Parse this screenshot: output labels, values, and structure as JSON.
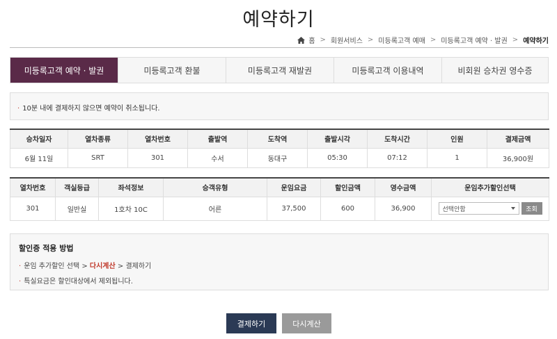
{
  "page": {
    "title": "예약하기"
  },
  "breadcrumb": {
    "home_label": "홈",
    "items": [
      "회원서비스",
      "미등록고객 예매",
      "미등록고객 예약 · 발권"
    ],
    "current": "예약하기"
  },
  "tabs": [
    {
      "label": "미등록고객 예약 · 발권"
    },
    {
      "label": "미등록고객 환불"
    },
    {
      "label": "미등록고객 재발권"
    },
    {
      "label": "미등록고객 이용내역"
    },
    {
      "label": "비회원 승차권 영수증"
    }
  ],
  "notice": {
    "text": "10분 내에 결제하지 않으면 예약이 취소됩니다."
  },
  "trip_table": {
    "headers": [
      "승차일자",
      "열차종류",
      "열차번호",
      "출발역",
      "도착역",
      "출발시각",
      "도착시간",
      "인원",
      "결제금액"
    ],
    "row": [
      "6월 11일",
      "SRT",
      "301",
      "수서",
      "동대구",
      "05:30",
      "07:12",
      "1",
      "36,900원"
    ]
  },
  "fare_table": {
    "headers": [
      "열차번호",
      "객실등급",
      "좌석정보",
      "승객유형",
      "운임요금",
      "할인금액",
      "영수금액",
      "운임추가할인선택"
    ],
    "row": [
      "301",
      "일반실",
      "1호차 10C",
      "어른",
      "37,500",
      "600",
      "36,900"
    ],
    "discount_select": "선택안함",
    "lookup_label": "조회"
  },
  "guide": {
    "title": "할인증 적용 방법",
    "line1_a": "운임 추가할인 선택 > ",
    "line1_hl": "다시계산",
    "line1_b": " > 결제하기",
    "line2": "특실요금은 할인대상에서 제외됩니다."
  },
  "buttons": {
    "pay": "결제하기",
    "recalc": "다시계산"
  },
  "colors": {
    "active_tab": "#5a2a48",
    "pay_button": "#2b3a55",
    "recalc_button": "#9a9a9a",
    "highlight": "#c0392b"
  }
}
